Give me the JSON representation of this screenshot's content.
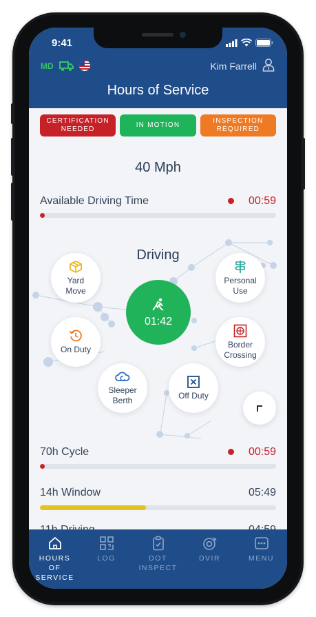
{
  "status_bar": {
    "time": "9:41"
  },
  "header": {
    "md_label": "MD",
    "user_name": "Kim Farrell",
    "title": "Hours of Service"
  },
  "badges": [
    {
      "label": "CERTIFICATION\nNEEDED",
      "color": "#c62127"
    },
    {
      "label": "IN MOTION",
      "color": "#1fb35a"
    },
    {
      "label": "INSPECTION\nREQUIRED",
      "color": "#ee7a23"
    }
  ],
  "speed": "40 Mph",
  "available_driving": {
    "label": "Available Driving Time",
    "value": "00:59",
    "progress": 0.02
  },
  "status_wheel": {
    "title": "Driving",
    "center_time": "01:42",
    "nodes": {
      "yard_move": "Yard\nMove",
      "personal_use": "Personal\nUse",
      "on_duty": "On Duty",
      "border_crossing": "Border\nCrossing",
      "sleeper_berth": "Sleeper\nBerth",
      "off_duty": "Off Duty"
    }
  },
  "cycle": {
    "label": "70h Cycle",
    "value": "00:59",
    "progress": 0.02
  },
  "window": {
    "label": "14h Window",
    "value": "05:49",
    "progress": 0.45
  },
  "peek_row": {
    "label": "11h Driving",
    "value": "04:59"
  },
  "tabs": [
    {
      "label": "HOURS\nOF\nSERVICE",
      "icon": "home-icon",
      "active": true
    },
    {
      "label": "LOG",
      "icon": "qr-log-icon",
      "active": false
    },
    {
      "label": "DOT\nINSPECT",
      "icon": "clipboard-icon",
      "active": false
    },
    {
      "label": "DVIR",
      "icon": "tire-icon",
      "active": false
    },
    {
      "label": "MENU",
      "icon": "menu-icon",
      "active": false
    }
  ]
}
